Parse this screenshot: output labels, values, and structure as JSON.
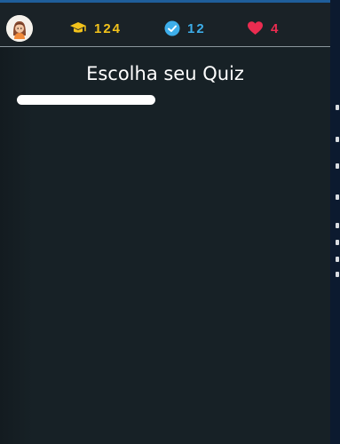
{
  "header": {
    "avatar_icon": "user-avatar-female",
    "xp": {
      "icon": "graduation-cap-icon",
      "value": "124",
      "color": "#f2c21b"
    },
    "completed": {
      "icon": "check-badge-icon",
      "value": "12",
      "color": "#3daeea"
    },
    "lives": {
      "icon": "heart-icon",
      "value": "4",
      "color": "#ea2c50"
    }
  },
  "main": {
    "title": "Escolha seu Quiz"
  }
}
